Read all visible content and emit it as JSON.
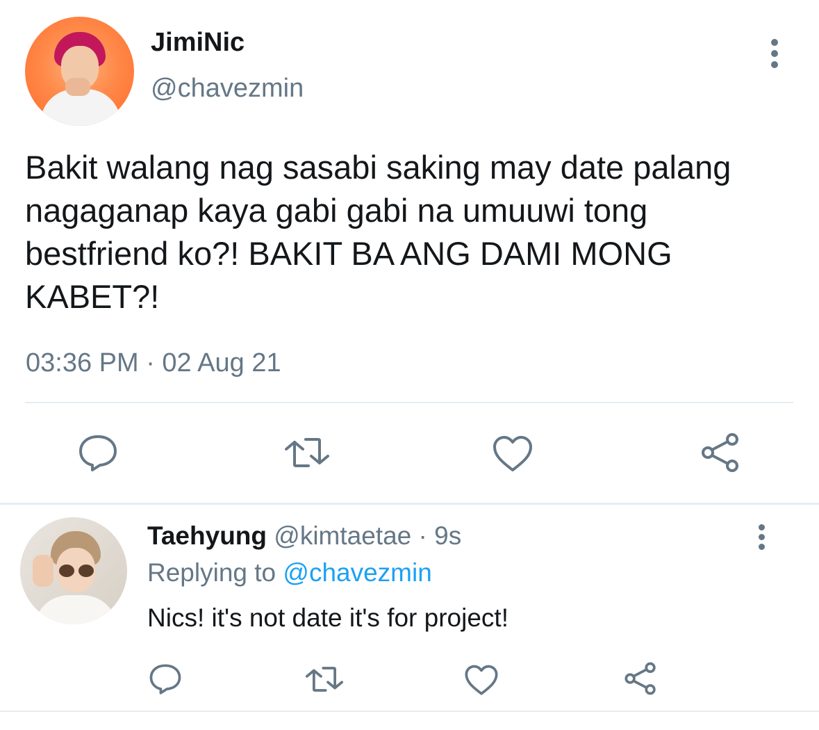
{
  "main_tweet": {
    "display_name": "JimiNic",
    "handle": "@chavezmin",
    "text": "Bakit walang nag sasabi saking may date palang nagaganap kaya gabi gabi na umuuwi tong bestfriend ko?! BAKIT BA ANG DAMI MONG KABET?!",
    "timestamp": "03:36 PM · 02 Aug 21"
  },
  "reply": {
    "display_name": "Taehyung",
    "meta": "@kimtaetae · 9s",
    "replying_prefix": "Replying to",
    "replying_to": "@chavezmin",
    "text": "Nics! it's not date it's for project!"
  },
  "icons": {
    "reply": "comment-icon",
    "retweet": "retweet-icon",
    "like": "heart-icon",
    "share": "share-icon",
    "more": "more-vertical-icon"
  },
  "colors": {
    "text_primary": "#14171a",
    "text_secondary": "#657786",
    "link": "#1da1f2",
    "divider": "#e6ecf0"
  }
}
